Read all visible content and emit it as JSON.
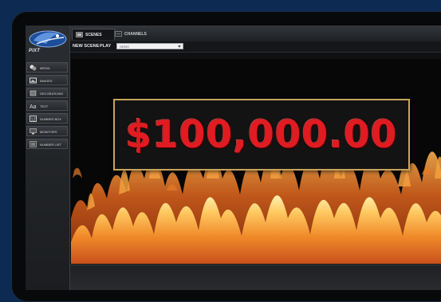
{
  "tabs": [
    {
      "label": "SCENES",
      "icon": "scenes-icon"
    },
    {
      "label": "CHANNELS",
      "icon": "channels-icon"
    }
  ],
  "logo": {
    "sub": "PIXT"
  },
  "toolbar": {
    "new_scene": "NEW SCENE",
    "play": "PLAY",
    "select_value": "DEMO"
  },
  "sidebar": {
    "items": [
      {
        "label": "MEDIA",
        "icon": "media-icon"
      },
      {
        "label": "IMAGES",
        "icon": "images-icon"
      },
      {
        "label": "DECORATIONS",
        "icon": "decorations-icon"
      },
      {
        "label": "TEXT",
        "icon": "text-icon"
      },
      {
        "label": "NUMBER BOX",
        "icon": "number-box-icon"
      },
      {
        "label": "MONITORS",
        "icon": "monitors-icon"
      },
      {
        "label": "NUMBER LIST",
        "icon": "number-list-icon"
      }
    ]
  },
  "stage": {
    "amount": "$100,000.00",
    "amount_color": "#e11b22",
    "frame_color": "#c9a45c"
  },
  "colors": {
    "page_background": "#0d2a52",
    "fire_orange": "#e0701e"
  }
}
